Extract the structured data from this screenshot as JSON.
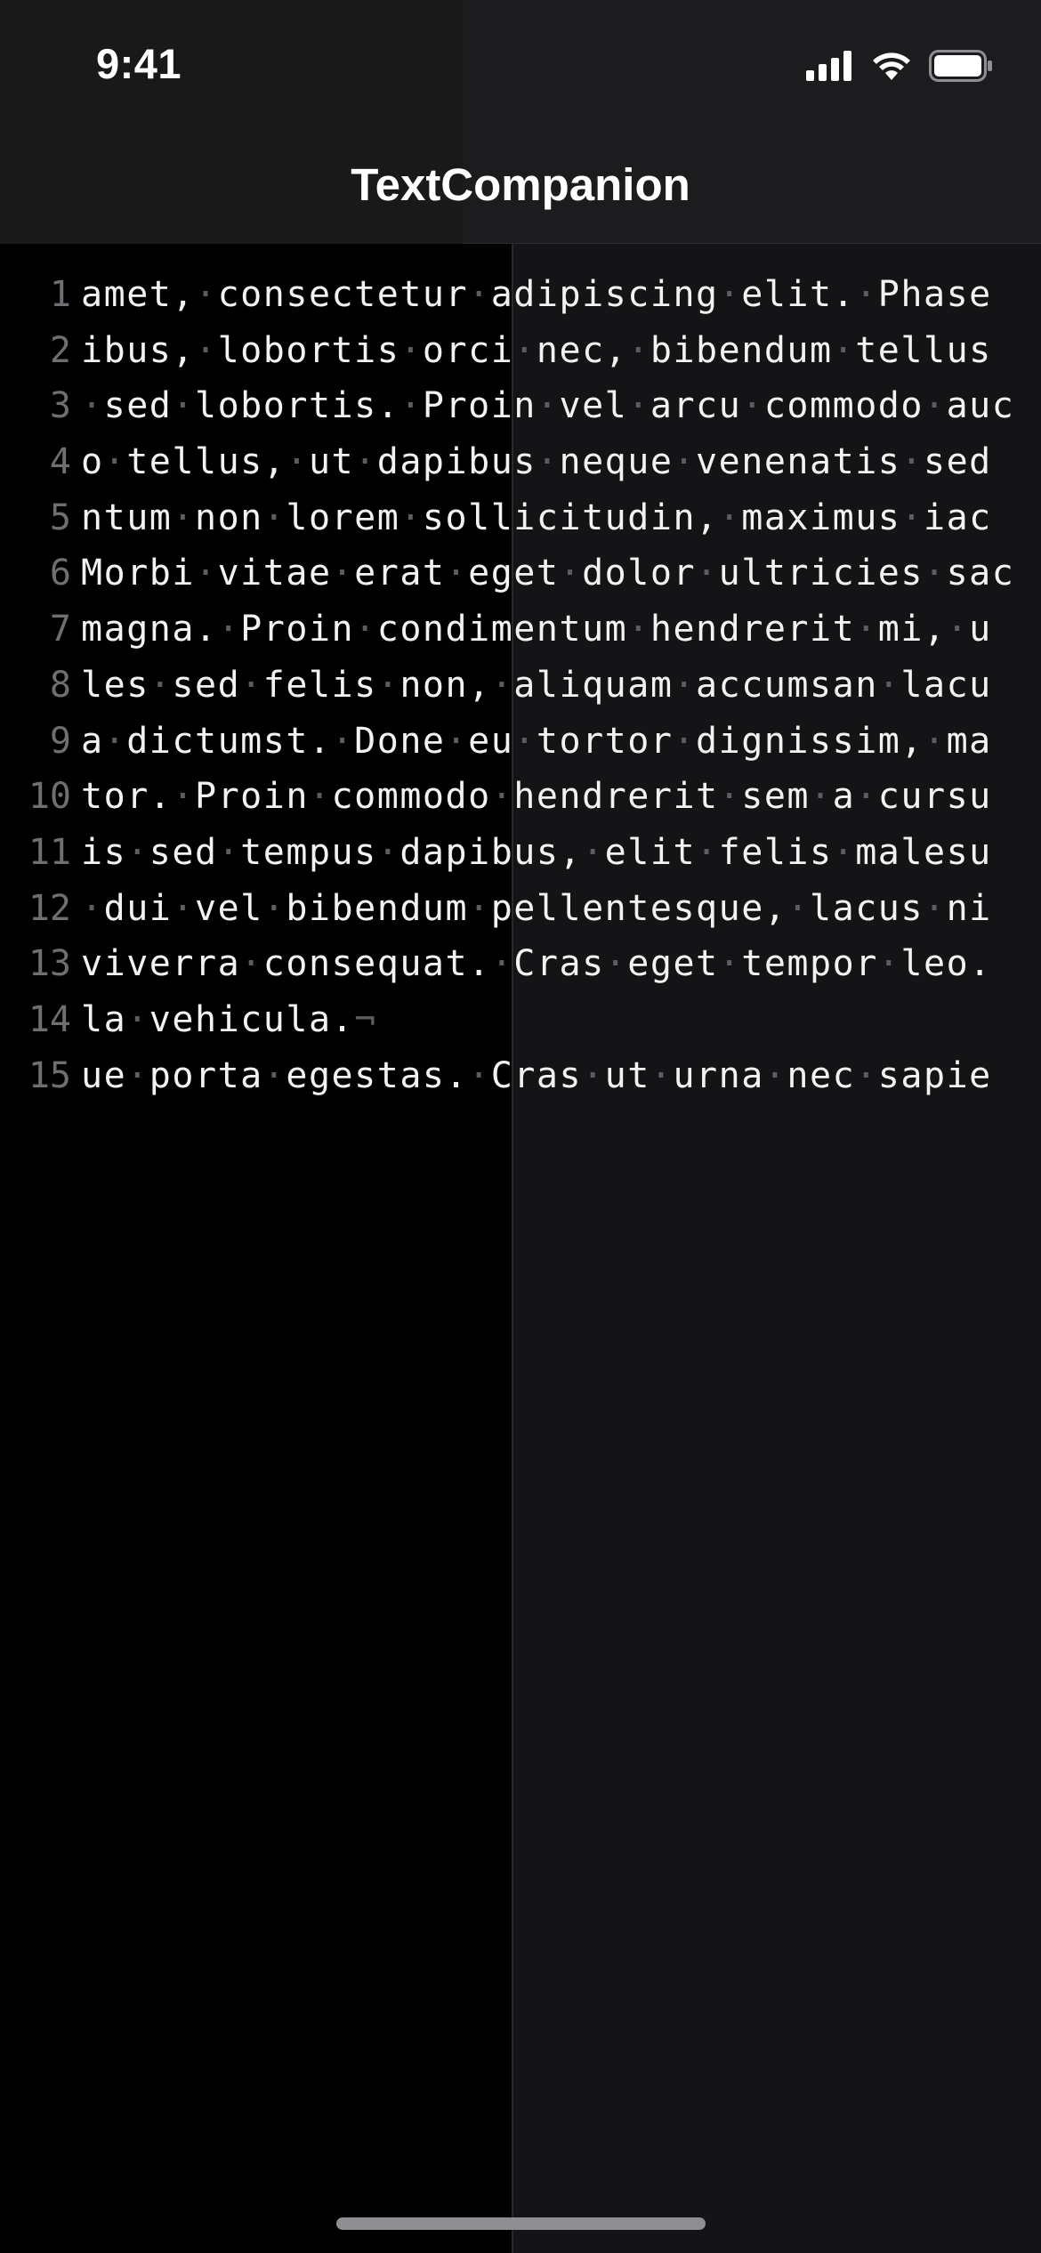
{
  "status_bar": {
    "time": "9:41",
    "icons": [
      "cellular-signal-icon",
      "wifi-icon",
      "battery-icon"
    ]
  },
  "nav": {
    "title": "TextCompanion"
  },
  "editor": {
    "whitespace_marker": "·",
    "line_end_marker": "¬",
    "lines": [
      {
        "number": "1",
        "text": "amet, consectetur adipiscing elit. Phase"
      },
      {
        "number": "2",
        "text": "ibus, lobortis orci nec, bibendum tellus"
      },
      {
        "number": "3",
        "text": " sed lobortis. Proin vel arcu commodo auc"
      },
      {
        "number": "4",
        "text": "o tellus, ut dapibus neque venenatis sed"
      },
      {
        "number": "5",
        "text": "ntum non lorem sollicitudin, maximus iac"
      },
      {
        "number": "6",
        "text": "Morbi vitae erat eget dolor ultricies sac"
      },
      {
        "number": "7",
        "text": "magna. Proin condimentum hendrerit mi, u"
      },
      {
        "number": "8",
        "text": "les sed felis non, aliquam accumsan lacu"
      },
      {
        "number": "9",
        "text": "a dictumst. Done eu tortor dignissim, ma"
      },
      {
        "number": "10",
        "text": "tor. Proin commodo hendrerit sem a cursu"
      },
      {
        "number": "11",
        "text": "is sed tempus dapibus, elit felis malesu"
      },
      {
        "number": "12",
        "text": " dui vel bibendum pellentesque, lacus ni"
      },
      {
        "number": "13",
        "text": "viverra consequat. Cras eget tempor leo."
      },
      {
        "number": "14",
        "text": "la vehicula.",
        "line_end": true
      },
      {
        "number": "15",
        "text": "ue porta egestas. Cras ut urna nec sapie"
      }
    ]
  },
  "colors": {
    "background": "#000000",
    "right_pane": "#141416",
    "nav_bar": "#1c1c1e",
    "text": "#f2f2f2",
    "line_number": "#6e6e73",
    "invisible_chars": "#5c5c61"
  }
}
